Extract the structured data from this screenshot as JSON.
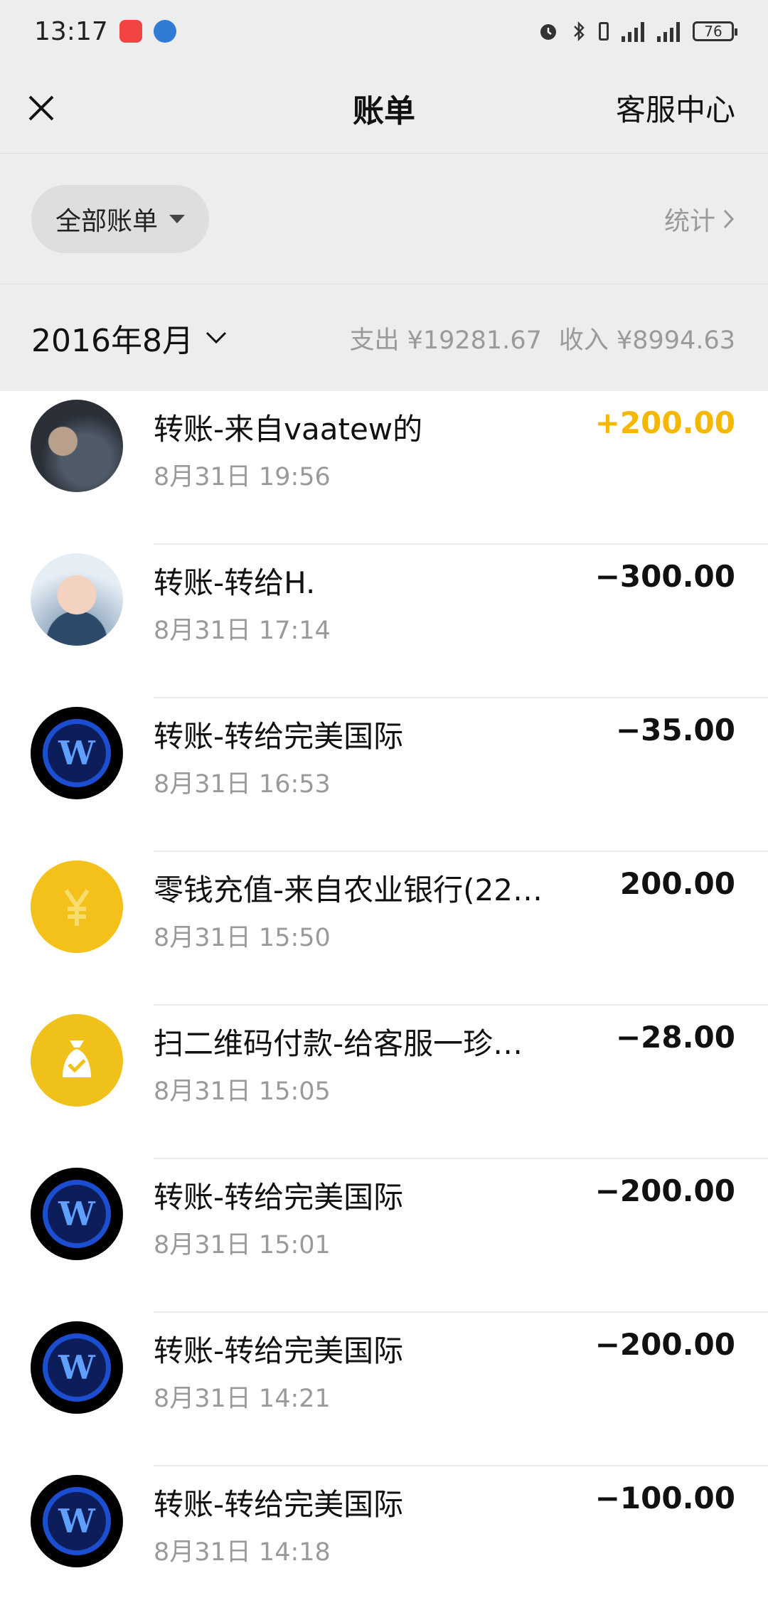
{
  "status_bar": {
    "time": "13:17",
    "battery": "76"
  },
  "nav": {
    "title": "账单",
    "right_link": "客服中心"
  },
  "filter": {
    "label": "全部账单",
    "stats_link": "统计"
  },
  "month_bar": {
    "month": "2016年8月",
    "expense": "支出 ¥19281.67",
    "income": "收入 ¥8994.63"
  },
  "transactions": [
    {
      "title": "转账-来自vaatew的",
      "time": "8月31日 19:56",
      "amount": "+200.00",
      "avatar": "photo-avatar-1"
    },
    {
      "title": "转账-转给H.",
      "time": "8月31日 17:14",
      "amount": "−300.00",
      "avatar": "photo-avatar-2"
    },
    {
      "title": "转账-转给完美国际",
      "time": "8月31日 16:53",
      "amount": "−35.00",
      "avatar": "w-logo-avatar"
    },
    {
      "title": "零钱充值-来自农业银行(22…",
      "time": "8月31日 15:50",
      "amount": "200.00",
      "avatar": "yen-icon"
    },
    {
      "title": "扫二维码付款-给客服一珍…",
      "time": "8月31日 15:05",
      "amount": "−28.00",
      "avatar": "money-bag-icon"
    },
    {
      "title": "转账-转给完美国际",
      "time": "8月31日 15:01",
      "amount": "−200.00",
      "avatar": "w-logo-avatar"
    },
    {
      "title": "转账-转给完美国际",
      "time": "8月31日 14:21",
      "amount": "−200.00",
      "avatar": "w-logo-avatar"
    },
    {
      "title": "转账-转给完美国际",
      "time": "8月31日 14:18",
      "amount": "−100.00",
      "avatar": "w-logo-avatar"
    }
  ],
  "colors": {
    "income_amount": "#f5b700",
    "header_bg": "#ededed",
    "yellow_icon": "#f3c11a",
    "w_logo_blue": "#1b4fd0"
  }
}
